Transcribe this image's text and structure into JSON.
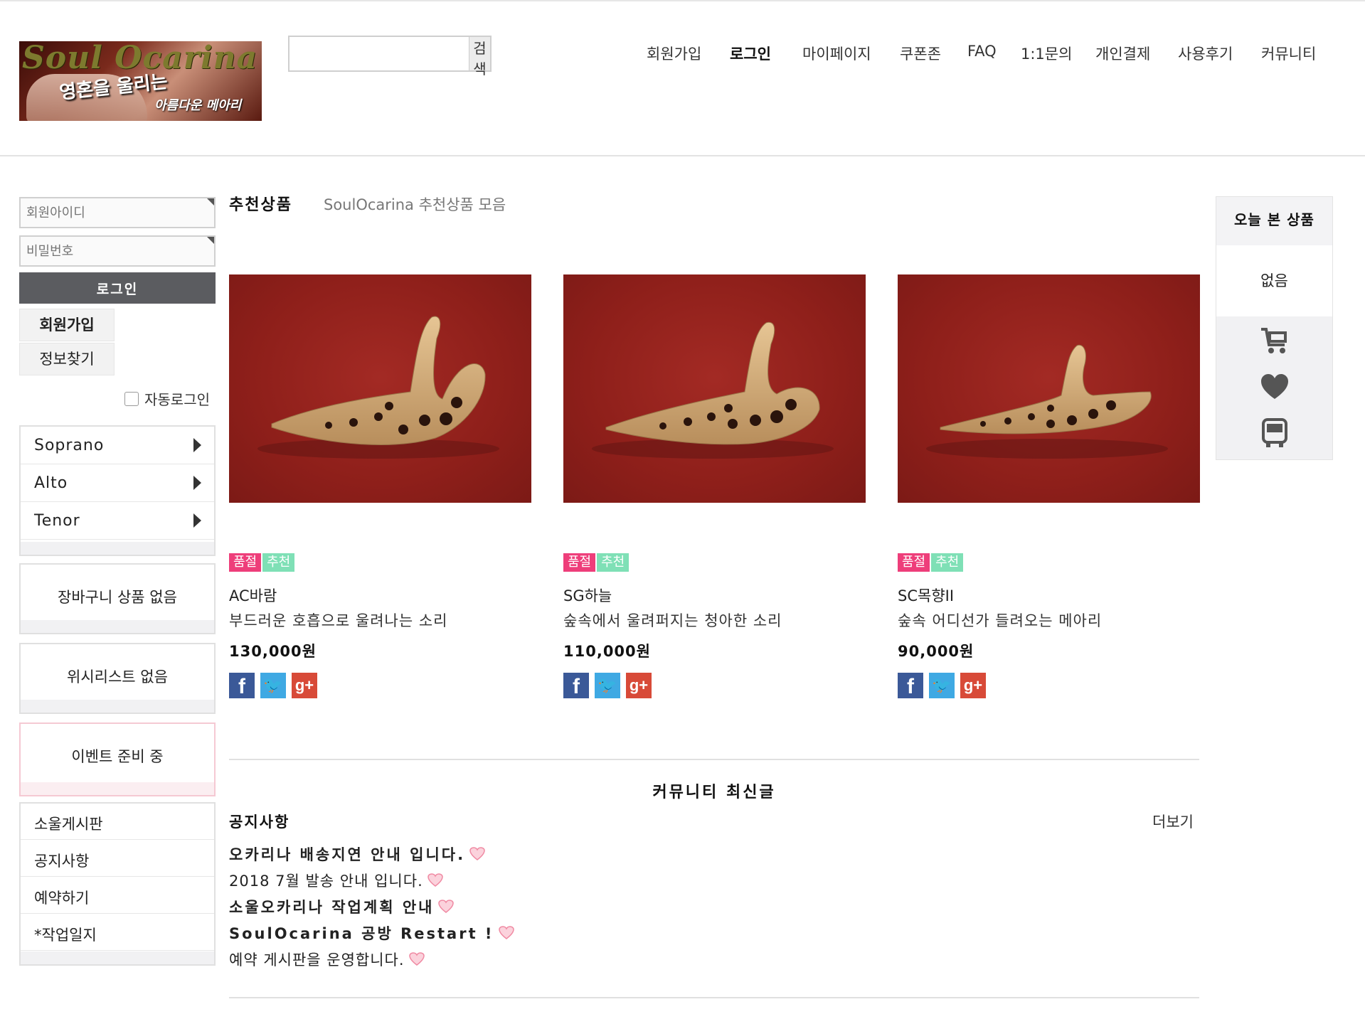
{
  "header": {
    "logo": {
      "brand": "Soul Ocarina",
      "tagline": "영혼을 울리는",
      "tagline2": "아름다운 메아리"
    },
    "search": {
      "value": "",
      "placeholder": "",
      "button_label": "검색"
    },
    "nav": [
      "회원가입",
      "로그인",
      "마이페이지",
      "쿠폰존",
      "FAQ",
      "1:1문의",
      "개인결제",
      "사용후기",
      "커뮤니티"
    ]
  },
  "login": {
    "id_placeholder": "회원아이디",
    "pw_placeholder": "비밀번호",
    "login_button": "로그인",
    "join_button": "회원가입",
    "find_button": "정보찾기",
    "autologin_label": "자동로그인"
  },
  "categories": [
    {
      "label": "Soprano"
    },
    {
      "label": "Alto"
    },
    {
      "label": "Tenor"
    }
  ],
  "cart_text": "장바구니 상품 없음",
  "wishlist_text": "위시리스트 없음",
  "event_text": "이벤트 준비 중",
  "boards": [
    "소울게시판",
    "공지사항",
    "예약하기",
    "*작업일지"
  ],
  "main": {
    "section_title": "추천상품",
    "section_subtitle": "SoulOcarina 추천상품 모음",
    "products": [
      {
        "badges": [
          "품절",
          "추천"
        ],
        "name": "AC바람",
        "desc": "부드러운 호흡으로 울려나는 소리",
        "price": "130,000원"
      },
      {
        "badges": [
          "품절",
          "추천"
        ],
        "name": "SG하늘",
        "desc": "숲속에서 울려퍼지는 청아한 소리",
        "price": "110,000원"
      },
      {
        "badges": [
          "품절",
          "추천"
        ],
        "name": "SC목향II",
        "desc": "숲속 어디선가 들려오는 메아리",
        "price": "90,000원"
      }
    ],
    "community_title": "커뮤니티 최신글",
    "notice_title": "공지사항",
    "more_label": "더보기",
    "posts": [
      {
        "title": "오카리나 배송지연 안내 입니다.",
        "bold": true
      },
      {
        "title": "2018 7월 발송 안내 입니다.",
        "bold": false
      },
      {
        "title": "소울오카리나 작업계획 안내",
        "bold": true
      },
      {
        "title": "SoulOcarina 공방 Restart !",
        "bold": true
      },
      {
        "title": "예약 게시판을 운영합니다.",
        "bold": false
      }
    ]
  },
  "quick": {
    "title": "오늘 본 상품",
    "empty": "없음",
    "icons": [
      "cart-icon",
      "heart-icon",
      "bus-icon"
    ]
  },
  "colors": {
    "sold_badge": "#ee3e7a",
    "rec_badge": "#7fe0b6",
    "login_btn": "#5b5c60",
    "product_bg": "#8e1f1a"
  }
}
